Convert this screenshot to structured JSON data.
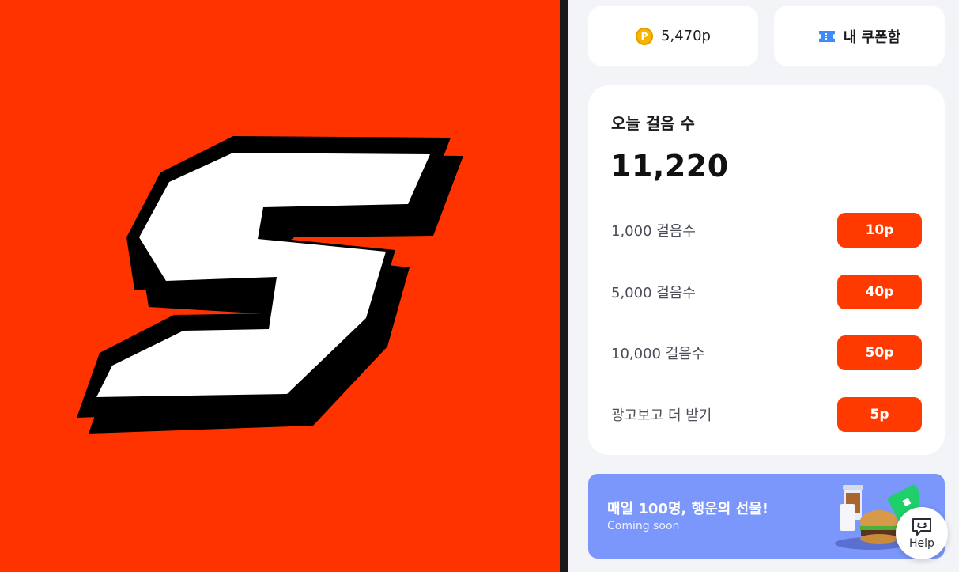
{
  "colors": {
    "brand_orange": "#ff3300",
    "accent_button": "#ff3a00",
    "banner_blue": "#7b97fb",
    "coin_yellow": "#f7b500",
    "ticket_blue": "#3c8cff"
  },
  "logo": {
    "letter": "S"
  },
  "top_cards": {
    "points": {
      "icon": "p-coin-icon",
      "coin_letter": "P",
      "value": "5,470p"
    },
    "coupons": {
      "icon": "ticket-icon",
      "label": "내 쿠폰함"
    }
  },
  "steps": {
    "title": "오늘 걸음 수",
    "count": "11,220",
    "rewards": [
      {
        "label": "1,000 걸음수",
        "button": "10p"
      },
      {
        "label": "5,000 걸음수",
        "button": "40p"
      },
      {
        "label": "10,000 걸음수",
        "button": "50p"
      },
      {
        "label": "광고보고 더 받기",
        "button": "5p"
      }
    ]
  },
  "banner": {
    "title": "매일 100명, 행운의 선물!",
    "subtitle": "Coming soon"
  },
  "help": {
    "icon": "smile-chat-icon",
    "label": "Help"
  }
}
